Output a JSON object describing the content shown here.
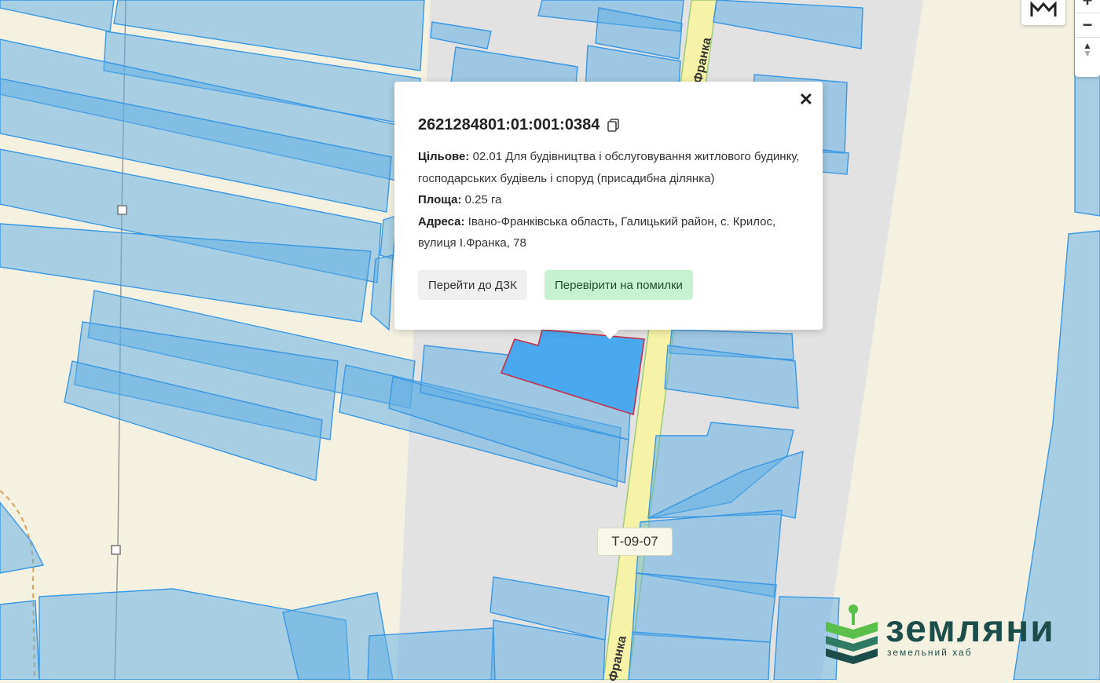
{
  "map": {
    "road_label_top": "Франка",
    "road_label_bottom": "Франка",
    "road_badge": "Т-09-07"
  },
  "popup": {
    "cadastral_number": "2621284801:01:001:0384",
    "purpose_label": "Цільове:",
    "purpose_value": "02.01 Для будівництва і обслуговування житлового будинку, господарських будівель і споруд (присадибна ділянка)",
    "area_label": "Площа:",
    "area_value": "0.25 га",
    "address_label": "Адреса:",
    "address_value": "Івано-Франківська область, Галицький район, с. Крилос, вулиця І.Франка, 78",
    "button_dzk": "Перейти до ДЗК",
    "button_check": "Перевірити на помилки",
    "close_glyph": "✕"
  },
  "controls": {
    "zoom_in": "+",
    "zoom_out": "−",
    "compass": "▲"
  },
  "logo": {
    "title": "Земляни",
    "subtitle": "земельний хаб"
  },
  "colors": {
    "parcel_fill": "#60aee4",
    "parcel_stroke": "#3a98e3",
    "selected_fill": "#4aa8ee",
    "selected_stroke": "#c2334a",
    "road": "#f6f3a8",
    "green_button": "#c7f2cf",
    "logo": "#1d4d4a"
  }
}
